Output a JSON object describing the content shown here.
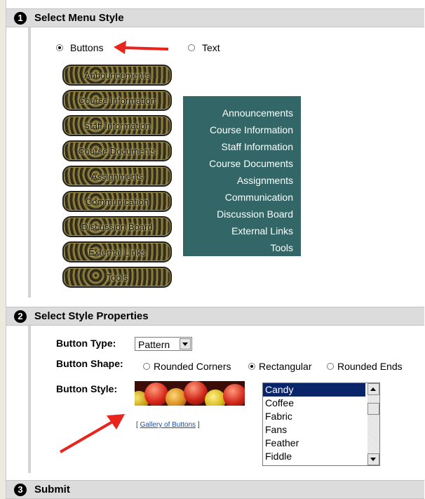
{
  "sections": [
    {
      "number": "1",
      "title": "Select Menu Style"
    },
    {
      "number": "2",
      "title": "Select Style Properties"
    },
    {
      "number": "3",
      "title": "Submit"
    }
  ],
  "menu_style": {
    "options": [
      {
        "label": "Buttons",
        "selected": true
      },
      {
        "label": "Text",
        "selected": false
      }
    ]
  },
  "menu_items": [
    "Announcements",
    "Course Information",
    "Staff Information",
    "Course Documents",
    "Assignments",
    "Communication",
    "Discussion Board",
    "External Links",
    "Tools"
  ],
  "style_properties": {
    "button_type": {
      "label": "Button Type:",
      "value": "Pattern"
    },
    "button_shape": {
      "label": "Button Shape:",
      "options": [
        {
          "label": "Rounded Corners",
          "selected": false
        },
        {
          "label": "Rectangular",
          "selected": true
        },
        {
          "label": "Rounded Ends",
          "selected": false
        }
      ]
    },
    "button_style": {
      "label": "Button Style:",
      "gallery_prefix": "[ ",
      "gallery_link": "Gallery of Buttons",
      "gallery_suffix": " ]",
      "list": [
        "Candy",
        "Coffee",
        "Fabric",
        "Fans",
        "Feather",
        "Fiddle"
      ],
      "selected": "Candy"
    }
  },
  "colors": {
    "text_menu_bg": "#336666",
    "annotation_arrow": "#e8241c",
    "list_selection": "#0a246a"
  }
}
